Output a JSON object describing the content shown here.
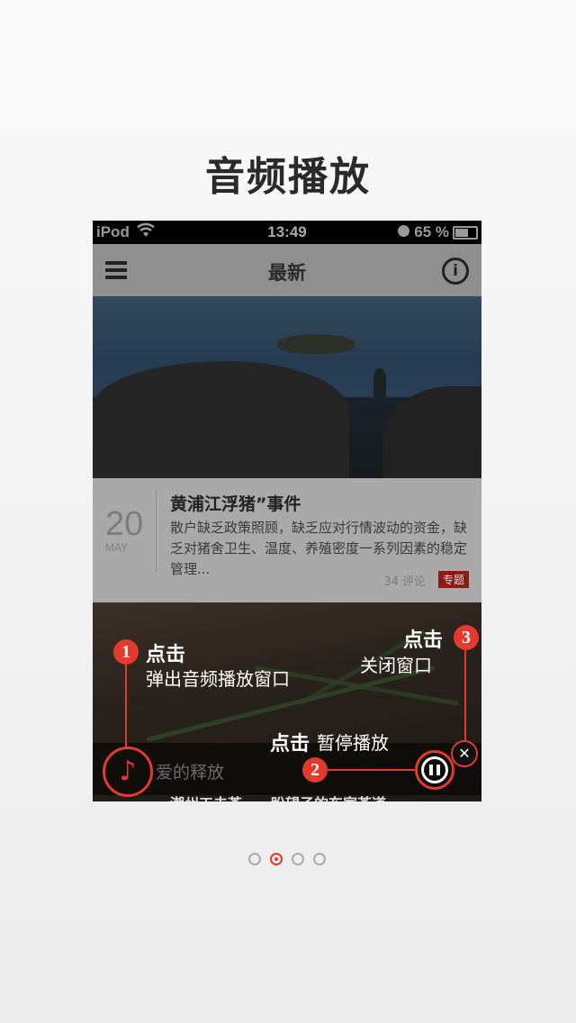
{
  "page": {
    "title": "音频播放"
  },
  "status_bar": {
    "carrier": "iPod",
    "time": "13:49",
    "battery": "65 %"
  },
  "nav": {
    "title": "最新"
  },
  "article": {
    "day": "20",
    "month": "MAY",
    "title": "黄浦江浮猪”事件",
    "summary": "散户缺乏政策照顾，缺乏应对行情波动的资金，缺乏对猪舍卫生、温度、养殖密度一系列因素的稳定管理...",
    "comments": "34 评论",
    "tag": "专题"
  },
  "next_article": {
    "title_partial": "潮州工夫茶　　盼望子的东家茶道"
  },
  "player": {
    "song": "爱的释放"
  },
  "tips": {
    "t1": {
      "num": "1",
      "action": "点击",
      "desc": "弹出音频播放窗口"
    },
    "t2": {
      "num": "2",
      "action": "点击",
      "desc": "暂停播放"
    },
    "t3": {
      "num": "3",
      "action": "点击",
      "desc": "关闭窗口"
    }
  },
  "pager": {
    "count": 4,
    "active_index": 1
  },
  "colors": {
    "accent": "#e23b2e"
  }
}
